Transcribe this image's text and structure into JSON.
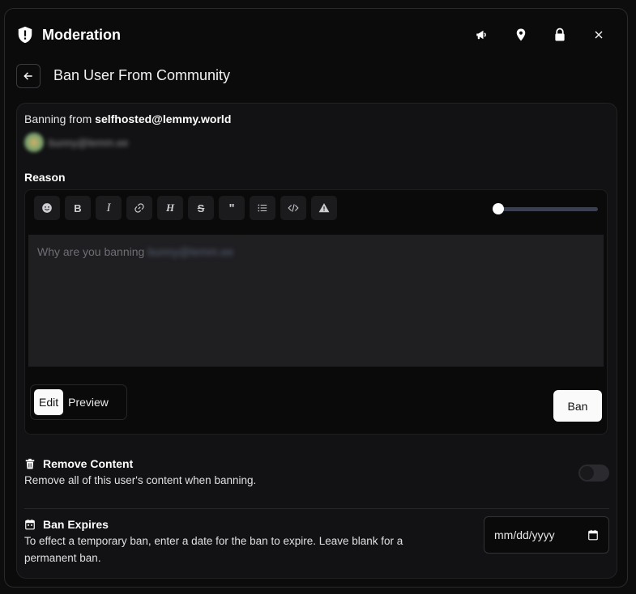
{
  "header": {
    "title": "Moderation",
    "actions": [
      "megaphone-icon",
      "pin-icon",
      "lock-icon",
      "close-icon"
    ]
  },
  "subheader": {
    "title": "Ban User From Community"
  },
  "banning": {
    "prefix": "Banning from ",
    "community": "selfhosted@lemmy.world",
    "username_blurred": "bunny@lemm.ee"
  },
  "reason": {
    "label": "Reason",
    "toolbar": [
      "emoji",
      "bold",
      "italic",
      "link",
      "header",
      "strikethrough",
      "quote",
      "list",
      "code",
      "spoiler"
    ],
    "placeholder_prefix": "Why are you banning ",
    "placeholder_user_blurred": "bunny@lemm.ee",
    "text_size": 0,
    "mode_edit": "Edit",
    "mode_preview": "Preview",
    "ban_label": "Ban"
  },
  "remove_content": {
    "title": "Remove Content",
    "description": "Remove all of this user's content when banning.",
    "enabled": false
  },
  "ban_expires": {
    "title": "Ban Expires",
    "description_line1": "To effect a temporary ban, enter a date for the ban to expire. Leave blank for a",
    "description_line2": "permanent ban.",
    "date_placeholder": "mm/dd/yyyy"
  }
}
